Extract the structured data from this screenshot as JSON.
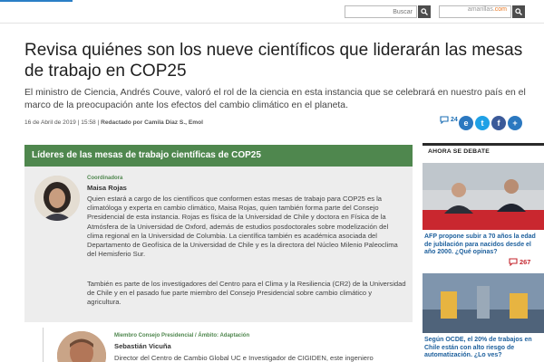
{
  "header": {
    "search_placeholder": "Buscar",
    "site_prefix": "amarillas",
    "site_suffix": ".com",
    "accent_color": "#2a7fc6"
  },
  "article": {
    "title": "Revisa quiénes son los nueve científicos que liderarán las mesas de trabajo en COP25",
    "lead": "El ministro de Ciencia, Andrés Couve, valoró el rol de la ciencia en esta instancia que se celebrará en nuestro país en el marco de la preocupación ante los efectos del cambio climático en el planeta.",
    "date": "16 de Abril de 2019 | 15:58 | ",
    "author": "Redactado por Camila Díaz S., Emol",
    "comments_count": "24",
    "share": {
      "emol_label": "e",
      "twitter_label": "t",
      "facebook_label": "f",
      "plus_label": "+"
    }
  },
  "panel": {
    "title": "Líderes de las mesas de trabajo científicas de COP25",
    "header_color": "#4f874e",
    "people": [
      {
        "role": "Coordinadora",
        "name": "Maisa Rojas",
        "bio": "Quien estará a cargo de los científicos que conformen estas mesas de trabajo para COP25 es la climatóloga y experta en cambio climático, Maisa Rojas, quien también forma parte del Consejo Presidencial de esta instancia. Rojas es física de la Universidad de Chile y doctora en Física de la Atmósfera de la Universidad de Oxford, además de estudios posdoctorales sobre modelización del clima regional en la Universidad de Columbia. La científica también es académica asociada del Departamento de Geofísica de la Universidad de Chile y es la directora del Núcleo Milenio Paleoclima del Hemisferio Sur.",
        "bio2": "También es parte de los investigadores del Centro para el Clima y la Resiliencia (CR2) de la Universidad de Chile y en el pasado fue parte miembro del Consejo Presidencial sobre cambio climático y agricultura."
      },
      {
        "role": "Miembro Consejo Presidencial / Ámbito: Adaptación",
        "name": "Sebastián Vicuña",
        "bio": "Director del Centro de Cambio Global UC e Investigador de CIGIDEN, este ingeniero"
      }
    ]
  },
  "sidebar": {
    "title": "AHORA SE DEBATE",
    "items": [
      {
        "text": "AFP propone subir a 70 años la edad de jubilación para nacidos desde el año 2000. ¿Qué opinas?",
        "comments": "267"
      },
      {
        "text": "Según OCDE, el 20% de trabajos en Chile están con alto riesgo de automatización. ¿Lo ves?"
      }
    ]
  }
}
